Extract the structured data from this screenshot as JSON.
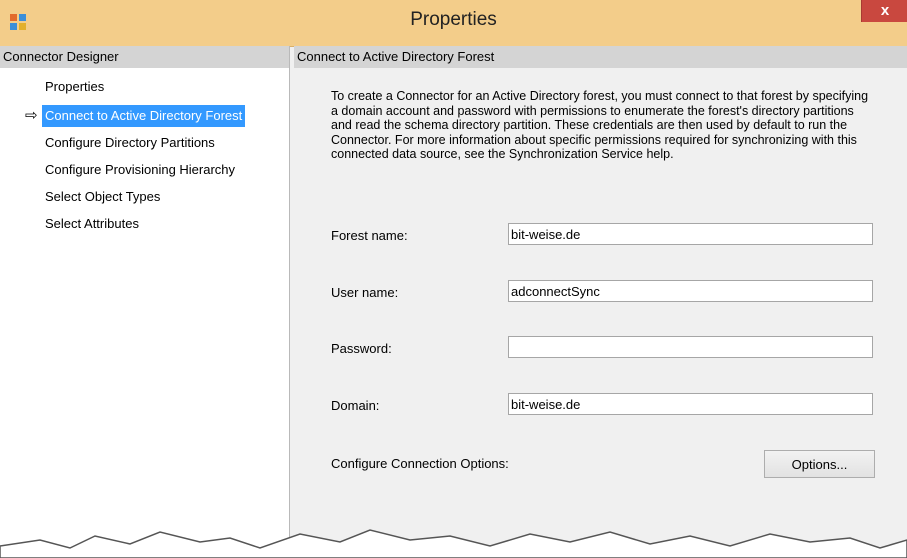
{
  "window": {
    "title": "Properties",
    "close_label": "x"
  },
  "left_pane": {
    "header": "Connector Designer",
    "items": [
      {
        "label": "Properties"
      },
      {
        "label": "Connect to Active Directory Forest",
        "selected": true
      },
      {
        "label": "Configure Directory Partitions"
      },
      {
        "label": "Configure Provisioning Hierarchy"
      },
      {
        "label": "Select Object Types"
      },
      {
        "label": "Select Attributes"
      }
    ],
    "current_indicator": "⇨"
  },
  "right_pane": {
    "header": "Connect to Active Directory Forest",
    "intro_text": "To create a Connector for an Active Directory forest, you must connect to that forest by specifying a domain account and password with permissions to enumerate the forest's directory partitions and read the schema directory partition. These credentials are then used by default to run the Connector. For more information about specific permissions required for synchronizing with this connected data source, see the Synchronization Service help.",
    "fields": {
      "forest_name": {
        "label": "Forest name:",
        "value": "bit-weise.de"
      },
      "user_name": {
        "label": "User name:",
        "value": "adconnectSync"
      },
      "password": {
        "label": "Password:",
        "value": ""
      },
      "domain": {
        "label": "Domain:",
        "value": "bit-weise.de"
      }
    },
    "connection_options": {
      "label": "Configure Connection Options:",
      "button_label": "Options..."
    }
  },
  "colors": {
    "titlebar": "#f3cd8a",
    "close": "#c9483f",
    "selection": "#3399ff",
    "pane_header": "#d4d4d4"
  }
}
